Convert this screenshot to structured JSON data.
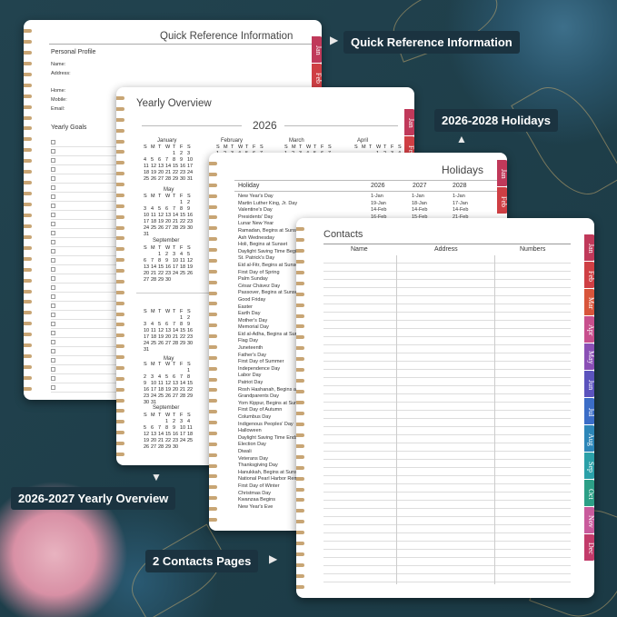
{
  "callouts": {
    "quick_reference": "Quick Reference Information",
    "holidays": "2026-2028 Holidays",
    "yearly_overview": "2026-2027 Yearly Overview",
    "contacts": "2 Contacts Pages"
  },
  "page_quickref": {
    "title": "Quick Reference Information",
    "personal_profile": "Personal Profile",
    "fields": [
      "Name:",
      "Address:",
      "Home:",
      "Mobile:",
      "Email:"
    ],
    "yearly_goals": "Yearly Goals"
  },
  "page_yearly": {
    "title": "Yearly Overview",
    "year": "2026",
    "months_row1": [
      "January",
      "February",
      "March",
      "April"
    ],
    "months_left": [
      "May",
      "September"
    ],
    "weekdays": "S M T W T F S"
  },
  "page_holidays": {
    "title": "Holidays",
    "col_holiday": "Holiday",
    "years": [
      "2026",
      "2027",
      "2028"
    ],
    "rows": [
      {
        "name": "New Year's Day",
        "d": [
          "1-Jan",
          "1-Jan",
          "1-Jan"
        ]
      },
      {
        "name": "Martin Luther King, Jr. Day",
        "d": [
          "19-Jan",
          "18-Jan",
          "17-Jan"
        ]
      },
      {
        "name": "Valentine's Day",
        "d": [
          "14-Feb",
          "14-Feb",
          "14-Feb"
        ]
      },
      {
        "name": "Presidents' Day",
        "d": [
          "16-Feb",
          "15-Feb",
          "21-Feb"
        ]
      },
      {
        "name": "Lunar New Year",
        "d": [
          "",
          "",
          ""
        ]
      },
      {
        "name": "Ramadan, Begins at Sunset",
        "d": [
          "",
          "",
          ""
        ]
      },
      {
        "name": "Ash Wednesday",
        "d": [
          "",
          "",
          ""
        ]
      },
      {
        "name": "Holi, Begins at Sunset",
        "d": [
          "",
          "",
          ""
        ]
      },
      {
        "name": "Daylight Saving Time Begins",
        "d": [
          "",
          "",
          ""
        ]
      },
      {
        "name": "St. Patrick's Day",
        "d": [
          "",
          "",
          ""
        ]
      },
      {
        "name": "Eid al-Fitr, Begins at Sunset",
        "d": [
          "",
          "",
          ""
        ]
      },
      {
        "name": "First Day of Spring",
        "d": [
          "",
          "",
          ""
        ]
      },
      {
        "name": "Palm Sunday",
        "d": [
          "",
          "",
          ""
        ]
      },
      {
        "name": "César Chávez Day",
        "d": [
          "",
          "",
          ""
        ]
      },
      {
        "name": "Passover, Begins at Sunset",
        "d": [
          "",
          "",
          ""
        ]
      },
      {
        "name": "Good Friday",
        "d": [
          "",
          "",
          ""
        ]
      },
      {
        "name": "Easter",
        "d": [
          "",
          "",
          ""
        ]
      },
      {
        "name": "Earth Day",
        "d": [
          "",
          "",
          ""
        ]
      },
      {
        "name": "Mother's Day",
        "d": [
          "",
          "",
          ""
        ]
      },
      {
        "name": "Memorial Day",
        "d": [
          "",
          "",
          ""
        ]
      },
      {
        "name": "Eid al-Adha, Begins at Sunset",
        "d": [
          "",
          "",
          ""
        ]
      },
      {
        "name": "Flag Day",
        "d": [
          "",
          "",
          ""
        ]
      },
      {
        "name": "Juneteenth",
        "d": [
          "",
          "",
          ""
        ]
      },
      {
        "name": "Father's Day",
        "d": [
          "",
          "",
          ""
        ]
      },
      {
        "name": "First Day of Summer",
        "d": [
          "",
          "",
          ""
        ]
      },
      {
        "name": "Independence Day",
        "d": [
          "",
          "",
          ""
        ]
      },
      {
        "name": "Labor Day",
        "d": [
          "",
          "",
          ""
        ]
      },
      {
        "name": "Patriot Day",
        "d": [
          "",
          "",
          ""
        ]
      },
      {
        "name": "Rosh Hashanah, Begins at Sunset",
        "d": [
          "",
          "",
          ""
        ]
      },
      {
        "name": "Grandparents Day",
        "d": [
          "",
          "",
          ""
        ]
      },
      {
        "name": "Yom Kippur, Begins at Sunset",
        "d": [
          "",
          "",
          ""
        ]
      },
      {
        "name": "First Day of Autumn",
        "d": [
          "",
          "",
          ""
        ]
      },
      {
        "name": "Columbus Day",
        "d": [
          "",
          "",
          ""
        ]
      },
      {
        "name": "Indigenous Peoples' Day",
        "d": [
          "",
          "",
          ""
        ]
      },
      {
        "name": "Halloween",
        "d": [
          "",
          "",
          ""
        ]
      },
      {
        "name": "Daylight Saving Time Ends",
        "d": [
          "",
          "",
          ""
        ]
      },
      {
        "name": "Election Day",
        "d": [
          "",
          "",
          ""
        ]
      },
      {
        "name": "Diwali",
        "d": [
          "",
          "",
          ""
        ]
      },
      {
        "name": "Veterans Day",
        "d": [
          "",
          "",
          ""
        ]
      },
      {
        "name": "Thanksgiving Day",
        "d": [
          "",
          "",
          ""
        ]
      },
      {
        "name": "Hanukkah, Begins at Sunset",
        "d": [
          "",
          "",
          ""
        ]
      },
      {
        "name": "National Pearl Harbor Remembrance Day",
        "d": [
          "",
          "",
          ""
        ]
      },
      {
        "name": "First Day of Winter",
        "d": [
          "",
          "",
          ""
        ]
      },
      {
        "name": "Christmas Day",
        "d": [
          "",
          "",
          ""
        ]
      },
      {
        "name": "Kwanzaa Begins",
        "d": [
          "",
          "",
          ""
        ]
      },
      {
        "name": "New Year's Eve",
        "d": [
          "",
          "",
          ""
        ]
      }
    ]
  },
  "page_contacts": {
    "title": "Contacts",
    "columns": [
      "Name",
      "Address",
      "Numbers"
    ]
  },
  "month_tabs": [
    {
      "label": "Jan",
      "color": "#c0395a"
    },
    {
      "label": "Feb",
      "color": "#cf3f44"
    },
    {
      "label": "Mar",
      "color": "#d8553b"
    },
    {
      "label": "Apr",
      "color": "#c84f8d"
    },
    {
      "label": "May",
      "color": "#8a4fb5"
    },
    {
      "label": "Jun",
      "color": "#5b53bd"
    },
    {
      "label": "Jul",
      "color": "#3b6dc7"
    },
    {
      "label": "Aug",
      "color": "#2c86b8"
    },
    {
      "label": "Sep",
      "color": "#2aa0a8"
    },
    {
      "label": "Oct",
      "color": "#2c9f86"
    },
    {
      "label": "Nov",
      "color": "#c95b9c"
    },
    {
      "label": "Dec",
      "color": "#c23b6a"
    }
  ]
}
